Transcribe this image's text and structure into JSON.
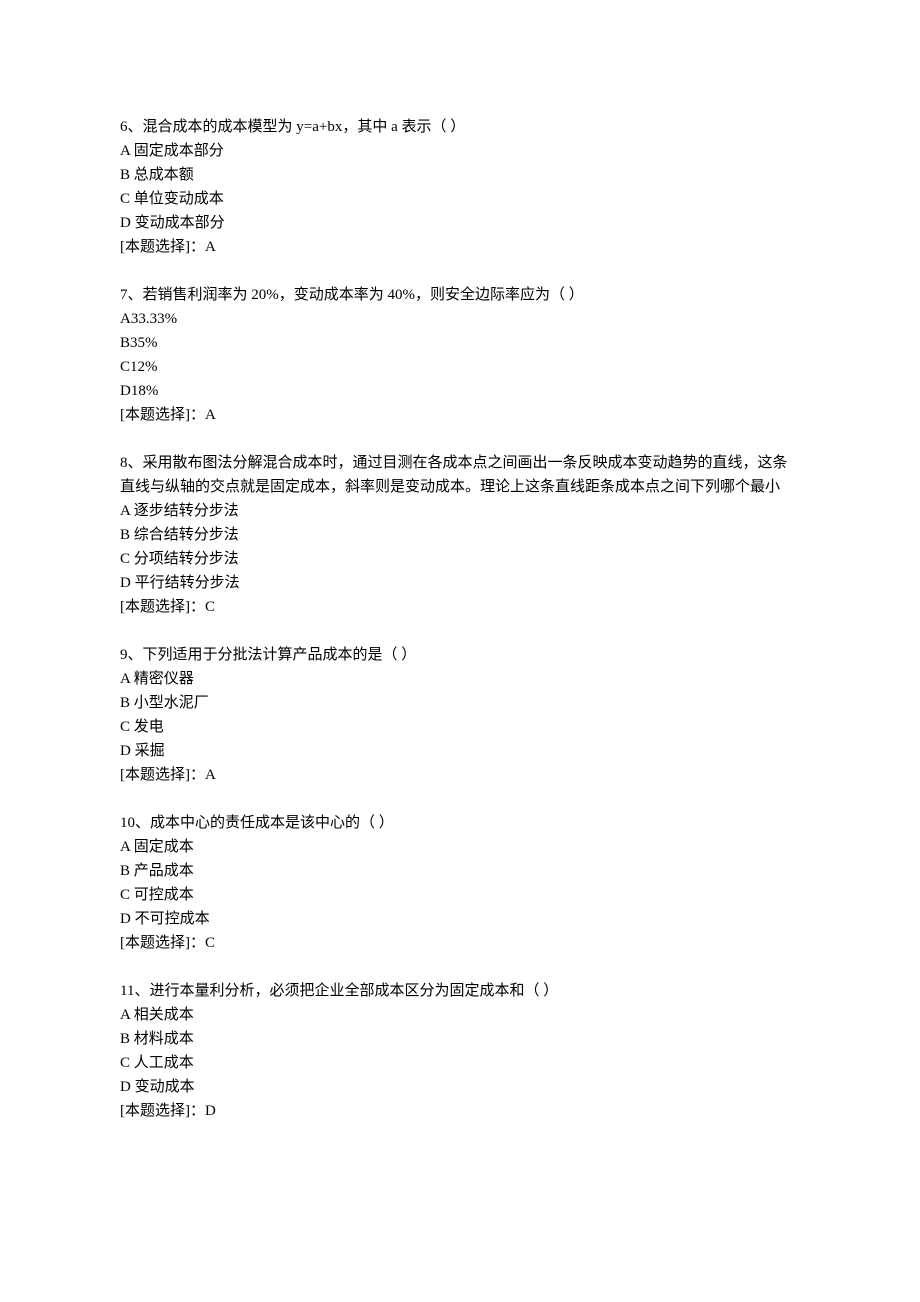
{
  "questions": [
    {
      "number": "6",
      "stem": "混合成本的成本模型为 y=a+bx，其中 a 表示（ ）",
      "options": [
        "A 固定成本部分",
        "B 总成本额",
        "C 单位变动成本",
        "D 变动成本部分"
      ],
      "answer_label": "[本题选择]：",
      "answer": "A"
    },
    {
      "number": "7",
      "stem": "若销售利润率为 20%，变动成本率为 40%，则安全边际率应为（ ）",
      "options": [
        "A33.33%",
        "B35%",
        "C12%",
        "D18%"
      ],
      "answer_label": "[本题选择]：",
      "answer": "A"
    },
    {
      "number": "8",
      "stem": "采用散布图法分解混合成本时，通过目测在各成本点之间画出一条反映成本变动趋势的直线，这条直线与纵轴的交点就是固定成本，斜率则是变动成本。理论上这条直线距条成本点之间下列哪个最小",
      "options": [
        "A 逐步结转分步法",
        "B 综合结转分步法",
        "C 分项结转分步法",
        "D 平行结转分步法"
      ],
      "answer_label": "[本题选择]：",
      "answer": "C"
    },
    {
      "number": "9",
      "stem": "下列适用于分批法计算产品成本的是（ ）",
      "options": [
        "A 精密仪器",
        "B 小型水泥厂",
        "C 发电",
        "D 采掘"
      ],
      "answer_label": "[本题选择]：",
      "answer": "A"
    },
    {
      "number": "10",
      "stem": "成本中心的责任成本是该中心的（ ）",
      "options": [
        "A 固定成本",
        "B 产品成本",
        "C 可控成本",
        "D 不可控成本"
      ],
      "answer_label": "[本题选择]：",
      "answer": "C"
    },
    {
      "number": "11",
      "stem": "进行本量利分析，必须把企业全部成本区分为固定成本和（ ）",
      "options": [
        "A 相关成本",
        "B 材料成本",
        "C 人工成本",
        "D 变动成本"
      ],
      "answer_label": "[本题选择]：",
      "answer": "D"
    }
  ]
}
